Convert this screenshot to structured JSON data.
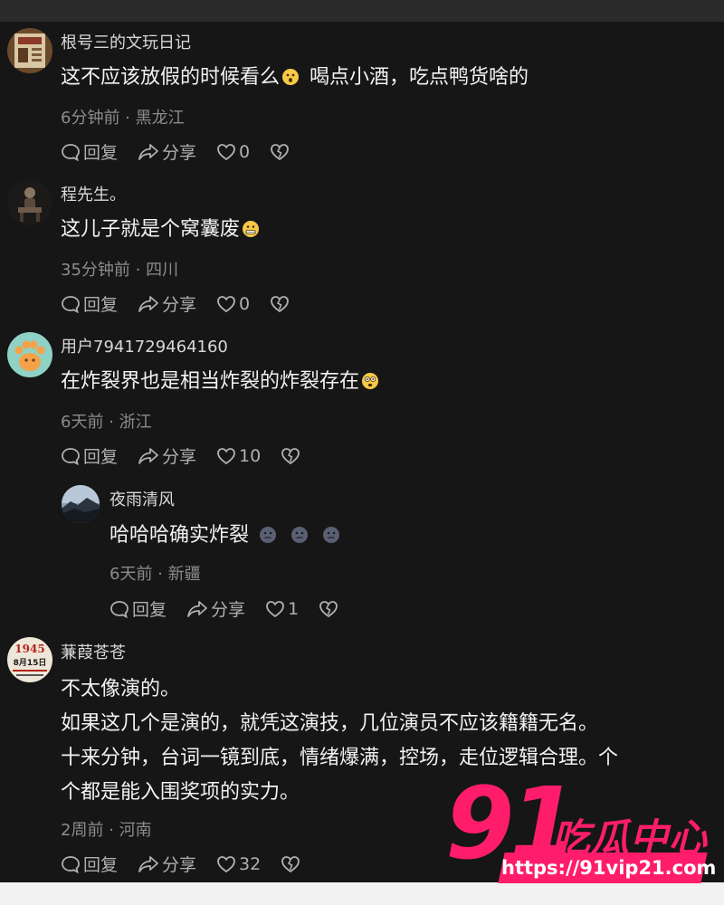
{
  "comments": [
    {
      "user": "根号三的文玩日记",
      "text": "这不应该放假的时候看么",
      "text_tail": "喝点小酒，吃点鸭货啥的",
      "meta": "6分钟前 · 黑龙江",
      "reply": "回复",
      "share": "分享",
      "likes": "0"
    },
    {
      "user": "程先生。",
      "text": "这儿子就是个窝囊废",
      "meta": "35分钟前 · 四川",
      "reply": "回复",
      "share": "分享",
      "likes": "0"
    },
    {
      "user": "用户7941729464160",
      "text": "在炸裂界也是相当炸裂的炸裂存在",
      "meta": "6天前 · 浙江",
      "reply": "回复",
      "share": "分享",
      "likes": "10"
    },
    {
      "user": "夜雨清风",
      "text": "哈哈哈确实炸裂",
      "meta": "6天前 · 新疆",
      "reply": "回复",
      "share": "分享",
      "likes": "1"
    },
    {
      "user": "蒹葭苍苍",
      "lines": [
        "不太像演的。",
        "如果这几个是演的，就凭这演技，几位演员不应该籍籍无名。",
        "十来分钟，台词一镜到底，情绪爆满，控场，走位逻辑合理。个",
        "个都是能入围奖项的实力。"
      ],
      "meta": "2周前 · 河南",
      "reply": "回复",
      "share": "分享",
      "likes": "32"
    }
  ],
  "avatar5_text": {
    "year": "1945",
    "date": "8月15日"
  },
  "watermark": {
    "number": "91",
    "text": "吃瓜中心",
    "url": "https://91vip21.com"
  },
  "colors": {
    "background": "#161616",
    "username": "#d8d8d8",
    "text": "#f2f2f2",
    "meta": "#8c8c8c",
    "watermark": "#ff1d6b"
  }
}
